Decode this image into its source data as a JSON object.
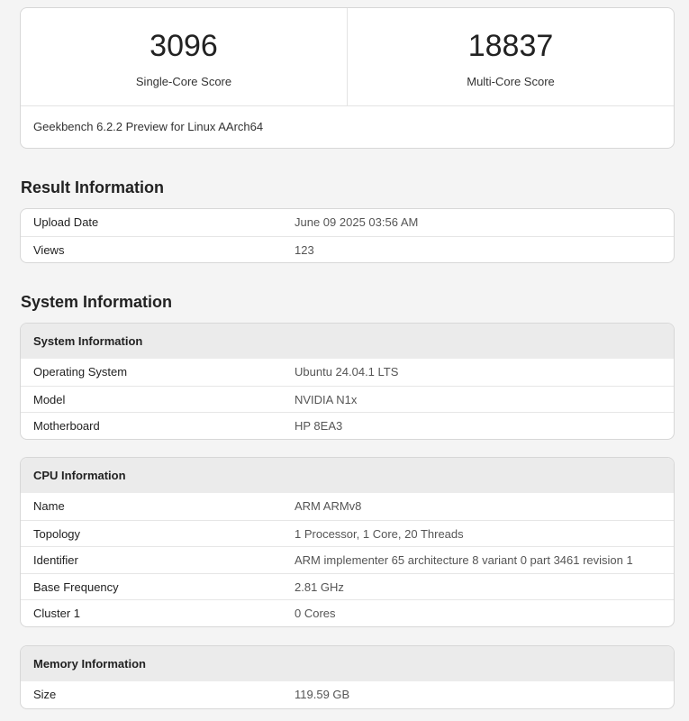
{
  "scores": {
    "single_core": {
      "value": "3096",
      "label": "Single-Core Score"
    },
    "multi_core": {
      "value": "18837",
      "label": "Multi-Core Score"
    },
    "version": "Geekbench 6.2.2 Preview for Linux AArch64"
  },
  "result_info": {
    "title": "Result Information",
    "rows": [
      {
        "key": "Upload Date",
        "value": "June 09 2025 03:56 AM"
      },
      {
        "key": "Views",
        "value": "123"
      }
    ]
  },
  "system_section_title": "System Information",
  "system_info": {
    "header": "System Information",
    "rows": [
      {
        "key": "Operating System",
        "value": "Ubuntu 24.04.1 LTS"
      },
      {
        "key": "Model",
        "value": "NVIDIA N1x"
      },
      {
        "key": "Motherboard",
        "value": "HP 8EA3"
      }
    ]
  },
  "cpu_info": {
    "header": "CPU Information",
    "rows": [
      {
        "key": "Name",
        "value": "ARM ARMv8"
      },
      {
        "key": "Topology",
        "value": "1 Processor, 1 Core, 20 Threads"
      },
      {
        "key": "Identifier",
        "value": "ARM implementer 65 architecture 8 variant 0 part 3461 revision 1"
      },
      {
        "key": "Base Frequency",
        "value": "2.81 GHz"
      },
      {
        "key": "Cluster 1",
        "value": "0 Cores"
      }
    ]
  },
  "memory_info": {
    "header": "Memory Information",
    "rows": [
      {
        "key": "Size",
        "value": "119.59 GB"
      }
    ]
  }
}
